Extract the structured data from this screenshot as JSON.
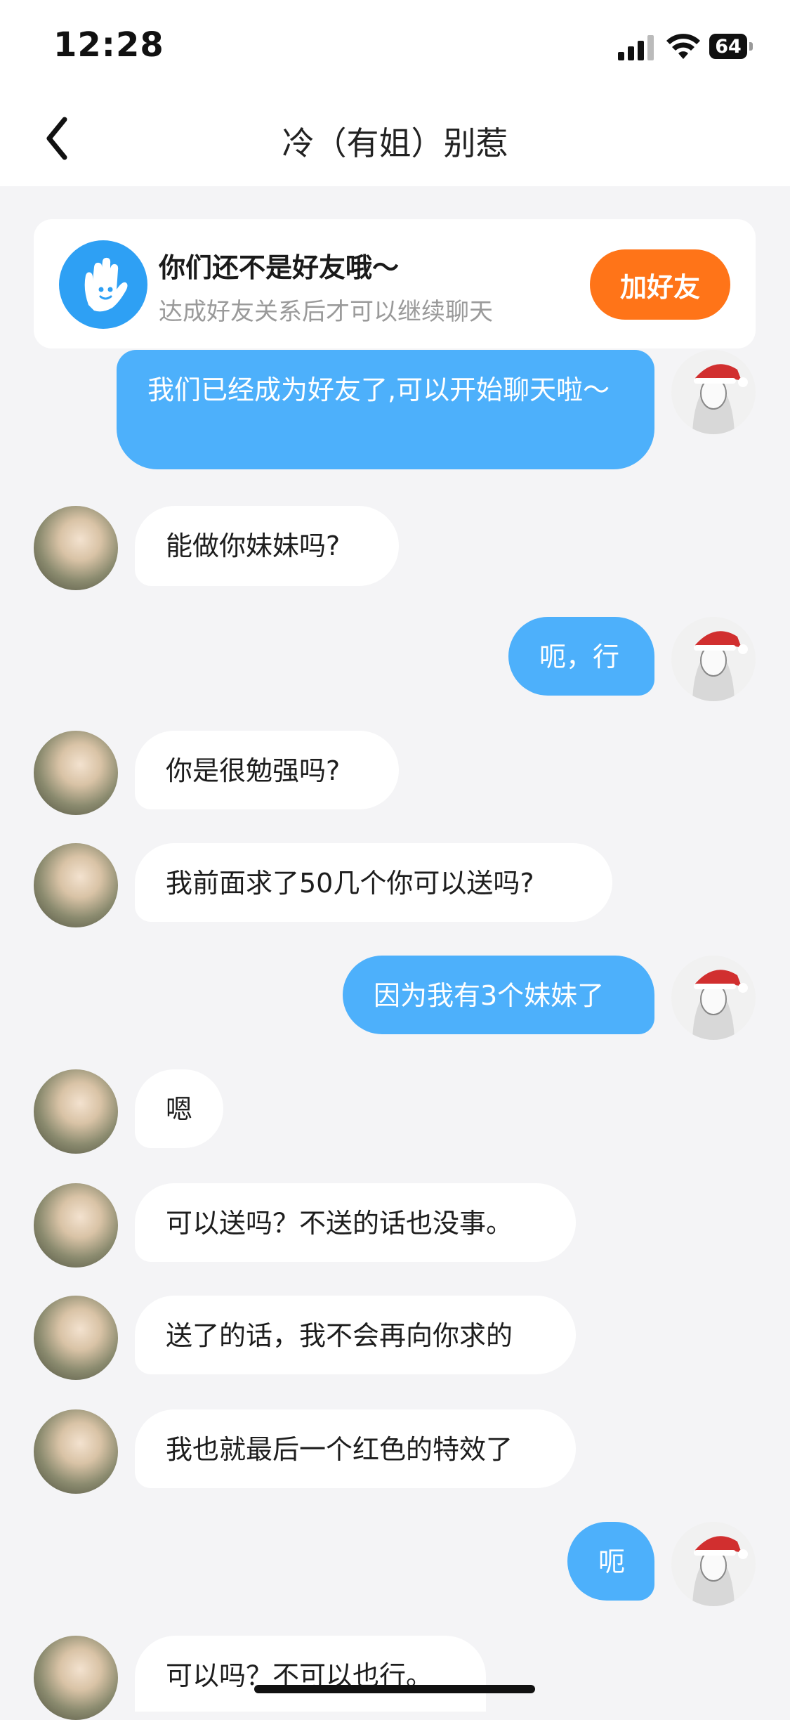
{
  "status": {
    "time": "12:28",
    "battery": "64"
  },
  "nav": {
    "title": "冷（有姐）别惹"
  },
  "banner": {
    "title": "你们还不是好友哦～",
    "subtitle": "达成好友关系后才可以继续聊天",
    "button": "加好友"
  },
  "messages": [
    {
      "from": "me",
      "text": "我们已经成为好友了,可以开始聊天啦～"
    },
    {
      "from": "her",
      "text": "能做你妹妹吗?"
    },
    {
      "from": "me",
      "text": "呃，行"
    },
    {
      "from": "her",
      "text": "你是很勉强吗?"
    },
    {
      "from": "her",
      "text": "我前面求了50几个你可以送吗?"
    },
    {
      "from": "me",
      "text": "因为我有3个妹妹了"
    },
    {
      "from": "her",
      "text": "嗯"
    },
    {
      "from": "her",
      "text": "可以送吗？不送的话也没事。"
    },
    {
      "from": "her",
      "text": "送了的话，我不会再向你求的"
    },
    {
      "from": "her",
      "text": "我也就最后一个红色的特效了"
    },
    {
      "from": "me",
      "text": "呃"
    },
    {
      "from": "her",
      "text": "可以吗？不可以也行。"
    }
  ],
  "colors": {
    "accent_blue": "#4db0fb",
    "add_orange": "#ff7418",
    "background": "#f4f4f6"
  }
}
